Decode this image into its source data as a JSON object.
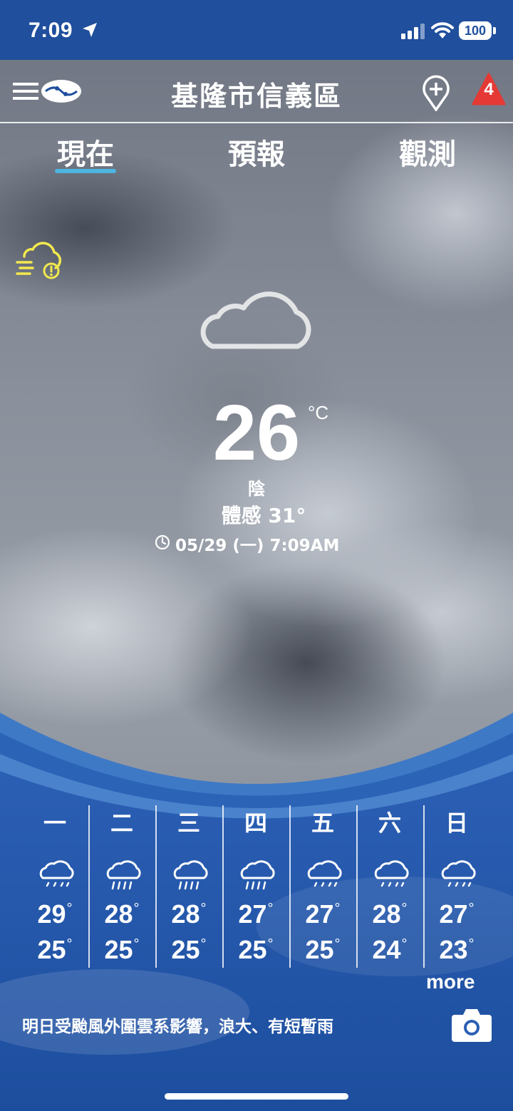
{
  "status_bar": {
    "time": "7:09",
    "battery": "100"
  },
  "header": {
    "location": "基隆市信義區",
    "alert_count": "4"
  },
  "tabs": [
    {
      "label": "現在",
      "active": true
    },
    {
      "label": "預報",
      "active": false
    },
    {
      "label": "觀測",
      "active": false
    }
  ],
  "current": {
    "temperature": "26",
    "unit": "°C",
    "condition": "陰",
    "feels_like": "體感 31°",
    "observed_at": "05/29 (一) 7:09AM",
    "icon": "cloud-icon",
    "warning_icon": "wind-warning-icon"
  },
  "forecast": [
    {
      "day": "一",
      "high": "29",
      "low": "25",
      "icon": "cloud-rain-icon"
    },
    {
      "day": "二",
      "high": "28",
      "low": "25",
      "icon": "cloud-heavy-rain-icon"
    },
    {
      "day": "三",
      "high": "28",
      "low": "25",
      "icon": "cloud-heavy-rain-icon"
    },
    {
      "day": "四",
      "high": "27",
      "low": "25",
      "icon": "cloud-heavy-rain-icon"
    },
    {
      "day": "五",
      "high": "27",
      "low": "25",
      "icon": "cloud-rain-icon"
    },
    {
      "day": "六",
      "high": "28",
      "low": "24",
      "icon": "cloud-rain-icon"
    },
    {
      "day": "日",
      "high": "27",
      "low": "23",
      "icon": "cloud-rain-icon"
    }
  ],
  "more_label": "more",
  "notice": "明日受颱風外圍雲系影響，浪大、有短暫雨",
  "colors": {
    "primary_blue": "#1f4f9d",
    "accent_cyan": "#4cb5e0",
    "alert_red": "#e53935",
    "warning_yellow": "#f2e94e"
  }
}
